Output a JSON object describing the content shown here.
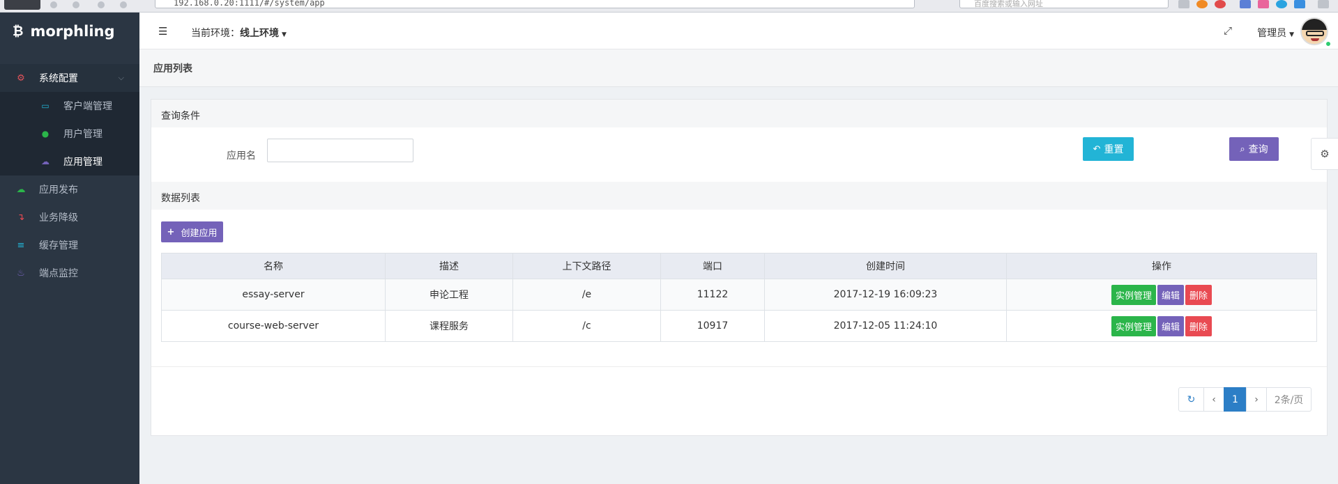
{
  "browser": {
    "url": "192.168.0.20:1111/#/system/app",
    "search_placeholder": "百度搜索或输入网址"
  },
  "brand": {
    "name": "morphling",
    "icon": "bitcoin-icon"
  },
  "sidebar": {
    "items": [
      {
        "label": "系统配置",
        "icon": "gear-icon",
        "color": "#e0525a",
        "expanded": true
      },
      {
        "label": "应用发布",
        "icon": "cloud-upload-icon",
        "color": "#2bb54a"
      },
      {
        "label": "业务降级",
        "icon": "level-down-icon",
        "color": "#e94a52"
      },
      {
        "label": "缓存管理",
        "icon": "database-icon",
        "color": "#22b4d6"
      },
      {
        "label": "端点监控",
        "icon": "fire-icon",
        "color": "#7462b9"
      }
    ],
    "submenu": [
      {
        "label": "客户端管理",
        "icon": "desktop-icon",
        "color": "#22b4d6"
      },
      {
        "label": "用户管理",
        "icon": "users-icon",
        "color": "#2bb54a"
      },
      {
        "label": "应用管理",
        "icon": "cloud-icon",
        "color": "#7462b9",
        "active": true
      }
    ]
  },
  "header": {
    "env_prefix": "当前环境：",
    "env_value": "线上环境",
    "user": "管理员"
  },
  "breadcrumb": "应用列表",
  "query": {
    "title": "查询条件",
    "label": "应用名",
    "value": "",
    "reset_label": "重置",
    "search_label": "查询"
  },
  "list": {
    "title": "数据列表",
    "create_label": "创建应用",
    "columns": [
      "名称",
      "描述",
      "上下文路径",
      "端口",
      "创建时间",
      "操作"
    ],
    "rows": [
      {
        "name": "essay-server",
        "desc": "申论工程",
        "path": "/e",
        "port": "11122",
        "created": "2017-12-19 16:09:23"
      },
      {
        "name": "course-web-server",
        "desc": "课程服务",
        "path": "/c",
        "port": "10917",
        "created": "2017-12-05 11:24:10"
      }
    ],
    "actions": {
      "instance": "实例管理",
      "edit": "编辑",
      "delete": "删除"
    }
  },
  "pagination": {
    "current": "1",
    "page_size": "2条/页"
  },
  "colors": {
    "sidebar_bg": "#2b3643",
    "primary": "#7462b9",
    "info": "#22b4d6",
    "success": "#2bb54a",
    "danger": "#e94a52",
    "page_active": "#2c7ec6"
  }
}
